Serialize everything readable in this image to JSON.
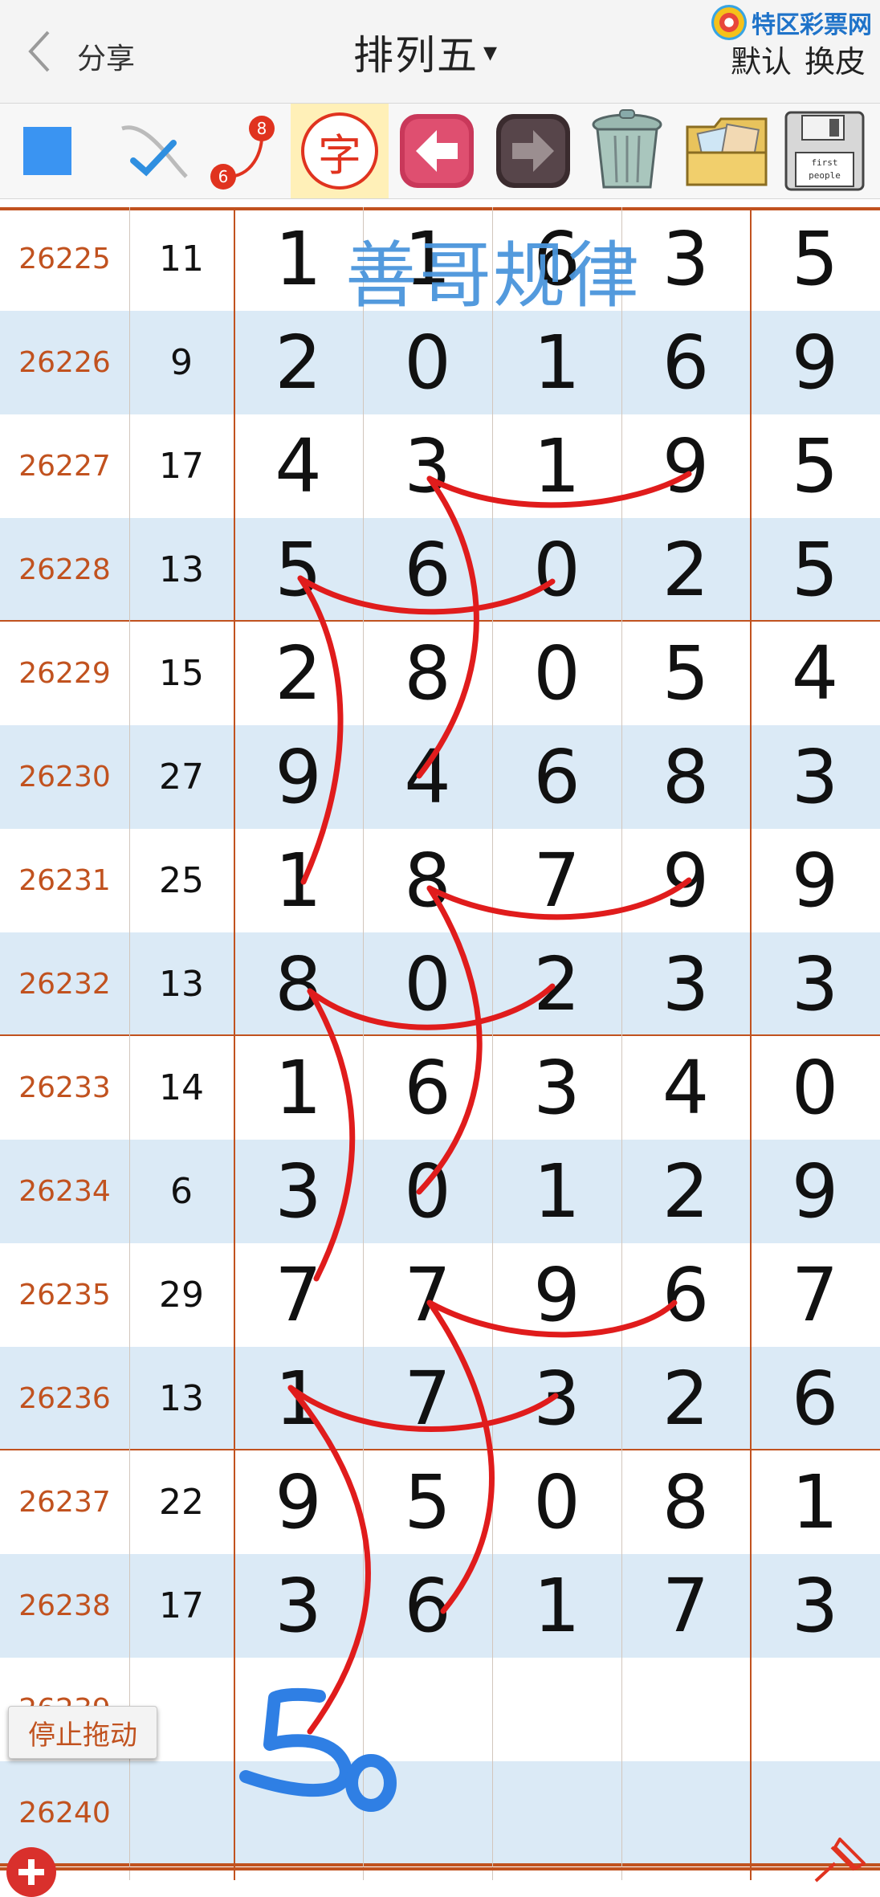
{
  "header": {
    "back_label": "分享",
    "title": "排列五",
    "caret": "▾",
    "default_label": "默认",
    "skin_label": "换皮",
    "logo_text": "特区彩票网"
  },
  "toolbar": {
    "items": [
      {
        "icon": "blue-square-icon"
      },
      {
        "icon": "checkmark-brush-icon"
      },
      {
        "icon": "line-6-8-icon",
        "text_a": "8",
        "text_b": "6"
      },
      {
        "icon": "char-zi-icon",
        "text": "字",
        "active": true
      },
      {
        "icon": "arrow-left-icon"
      },
      {
        "icon": "arrow-right-icon"
      },
      {
        "icon": "trash-can-icon"
      },
      {
        "icon": "photos-folder-icon"
      },
      {
        "icon": "floppy-disk-icon",
        "text_a": "first",
        "text_b": "people"
      }
    ]
  },
  "watermark": "善哥规律",
  "handwritten_note": "50",
  "rows": [
    {
      "issue": "26225",
      "sum": "11",
      "digits": [
        "1",
        "1",
        "6",
        "3",
        "5"
      ]
    },
    {
      "issue": "26226",
      "sum": "9",
      "digits": [
        "2",
        "0",
        "1",
        "6",
        "9"
      ]
    },
    {
      "issue": "26227",
      "sum": "17",
      "digits": [
        "4",
        "3",
        "1",
        "9",
        "5"
      ]
    },
    {
      "issue": "26228",
      "sum": "13",
      "digits": [
        "5",
        "6",
        "0",
        "2",
        "5"
      ]
    },
    {
      "issue": "26229",
      "sum": "15",
      "digits": [
        "2",
        "8",
        "0",
        "5",
        "4"
      ]
    },
    {
      "issue": "26230",
      "sum": "27",
      "digits": [
        "9",
        "4",
        "6",
        "8",
        "3"
      ]
    },
    {
      "issue": "26231",
      "sum": "25",
      "digits": [
        "1",
        "8",
        "7",
        "9",
        "9"
      ]
    },
    {
      "issue": "26232",
      "sum": "13",
      "digits": [
        "8",
        "0",
        "2",
        "3",
        "3"
      ]
    },
    {
      "issue": "26233",
      "sum": "14",
      "digits": [
        "1",
        "6",
        "3",
        "4",
        "0"
      ]
    },
    {
      "issue": "26234",
      "sum": "6",
      "digits": [
        "3",
        "0",
        "1",
        "2",
        "9"
      ]
    },
    {
      "issue": "26235",
      "sum": "29",
      "digits": [
        "7",
        "7",
        "9",
        "6",
        "7"
      ]
    },
    {
      "issue": "26236",
      "sum": "13",
      "digits": [
        "1",
        "7",
        "3",
        "2",
        "6"
      ]
    },
    {
      "issue": "26237",
      "sum": "22",
      "digits": [
        "9",
        "5",
        "0",
        "8",
        "1"
      ]
    },
    {
      "issue": "26238",
      "sum": "17",
      "digits": [
        "3",
        "6",
        "1",
        "7",
        "3"
      ]
    },
    {
      "issue": "26239",
      "sum": "",
      "digits": [
        "",
        "",
        "",
        "",
        ""
      ]
    },
    {
      "issue": "26240",
      "sum": "",
      "digits": [
        "",
        "",
        "",
        "",
        ""
      ]
    }
  ],
  "stop_drag_label": "停止拖动",
  "colors": {
    "accent": "#c1521f",
    "alt_row": "#dbeaf6",
    "ink": "#e01c1c",
    "watermark": "#4a95dc"
  }
}
